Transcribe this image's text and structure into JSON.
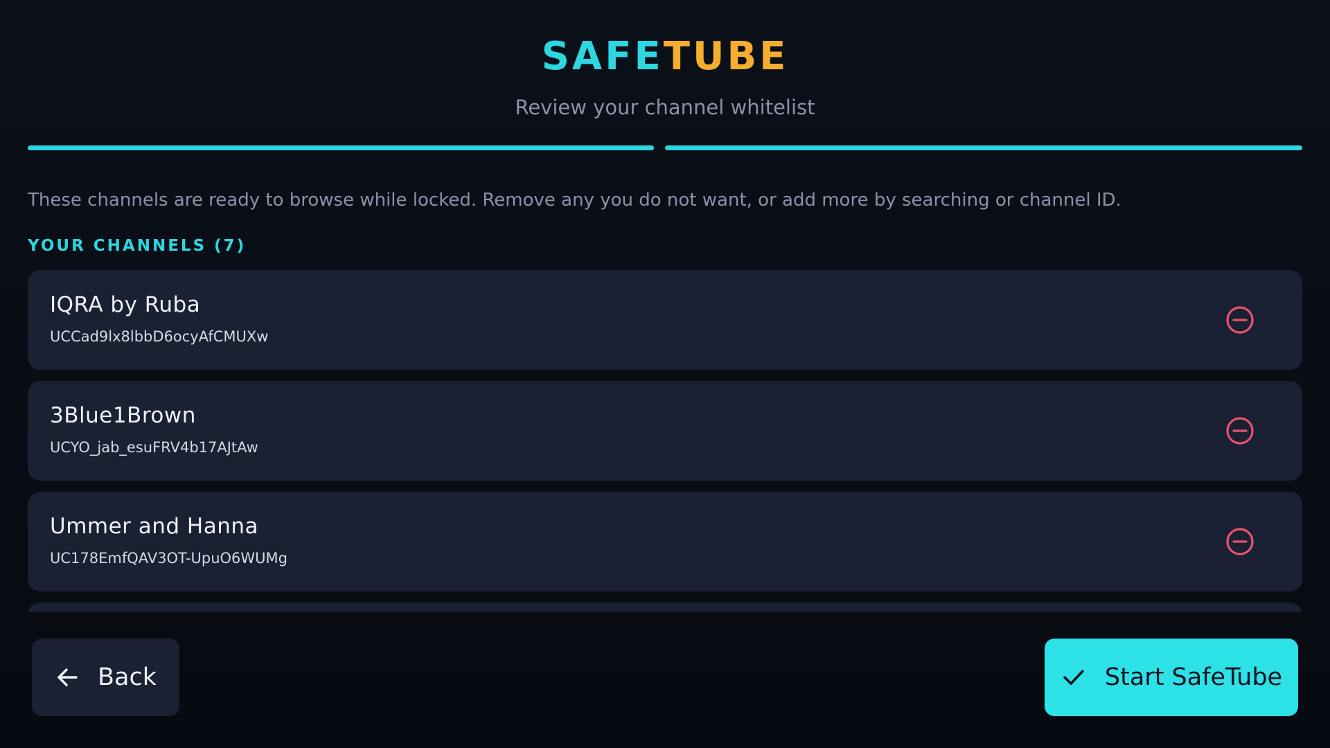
{
  "app": {
    "logo_part1": "SAFE",
    "logo_part2": "TUBE",
    "subtitle": "Review your channel whitelist"
  },
  "colors": {
    "accent_cyan": "#2ed6df",
    "accent_orange": "#f6ad2e",
    "remove_red": "#e8546b",
    "card_bg": "#1a2133",
    "page_bg": "#0b1019"
  },
  "progress": {
    "steps_total": 2,
    "steps_completed": 2
  },
  "description": "These channels are ready to browse while locked. Remove any you do not want, or add more by searching or channel ID.",
  "section": {
    "label": "Your Channels (7)"
  },
  "channels": [
    {
      "name": "IQRA by Ruba",
      "id": "UCCad9lx8lbbD6ocyAfCMUXw",
      "icon": "minus-circle-icon"
    },
    {
      "name": "3Blue1Brown",
      "id": "UCYO_jab_esuFRV4b17AJtAw",
      "icon": "minus-circle-icon"
    },
    {
      "name": "Ummer and Hanna",
      "id": "UC178EmfQAV3OT-UpuO6WUMg",
      "icon": "minus-circle-icon"
    },
    {
      "name": "",
      "id": "",
      "icon": "minus-circle-icon"
    }
  ],
  "footer": {
    "back_label": "Back",
    "back_icon": "arrow-left-icon",
    "start_label": "Start SafeTube",
    "start_icon": "check-icon"
  }
}
